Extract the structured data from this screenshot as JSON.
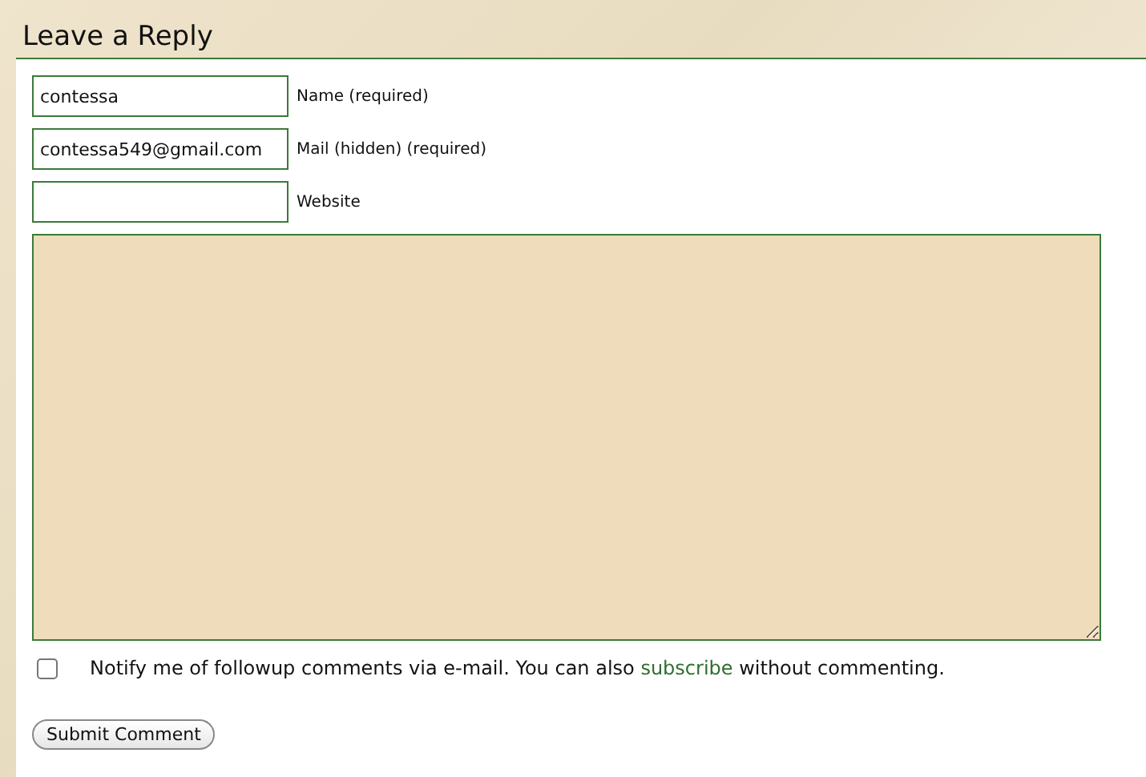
{
  "heading": "Leave a Reply",
  "fields": [
    {
      "value": "contessa",
      "label": "Name (required)"
    },
    {
      "value": "contessa549@gmail.com",
      "label": "Mail (hidden) (required)"
    },
    {
      "label": "Website"
    }
  ],
  "notify": {
    "checked": false,
    "before": "Notify me of followup comments via e-mail. You can also ",
    "link": "subscribe",
    "after": " without commenting."
  },
  "submit": "Submit Comment"
}
